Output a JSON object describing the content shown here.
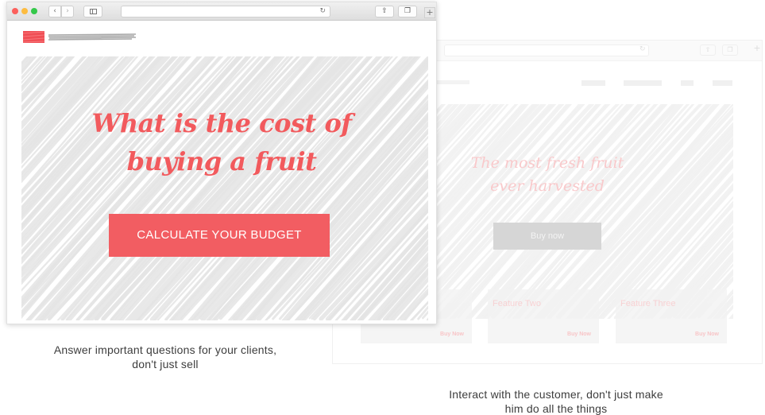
{
  "front_browser": {
    "toolbar": {
      "back_icon": "chevron-left-icon",
      "forward_icon": "chevron-right-icon",
      "sidebar_icon": "sidebar-icon",
      "reload_icon": "reload-icon",
      "share_icon": "share-icon",
      "tabs_icon": "tabs-icon",
      "new_tab_icon": "plus-icon",
      "back_glyph": "‹",
      "forward_glyph": "›",
      "reload_glyph": "↻",
      "share_glyph": "⇧",
      "tabs_glyph": "❐",
      "new_tab_glyph": "+"
    },
    "hero": {
      "headline_line1": "What is the cost of",
      "headline_line2": "buying a fruit",
      "cta_label": "CALCULATE YOUR BUDGET"
    },
    "colors": {
      "accent": "#f25d62",
      "headline": "#f25a5d",
      "scribble": "#e4e4e4"
    }
  },
  "back_browser": {
    "toolbar": {
      "reload_glyph": "↻",
      "share_glyph": "⇧",
      "tabs_glyph": "❐",
      "new_tab_glyph": "+"
    },
    "hero": {
      "headline_line1": "The most fresh fruit",
      "headline_line2": "ever harvested",
      "cta_label": "Buy now"
    },
    "features": [
      {
        "title": "",
        "buy_label": "Buy Now"
      },
      {
        "title": "Feature Two",
        "buy_label": "Buy Now"
      },
      {
        "title": "Feature Three",
        "buy_label": "Buy Now"
      }
    ]
  },
  "captions": {
    "left_line1": "Answer important questions for your clients,",
    "left_line2": "don't just sell",
    "right_line1": "Interact with the customer, don't just make",
    "right_line2": "him do all the things"
  }
}
